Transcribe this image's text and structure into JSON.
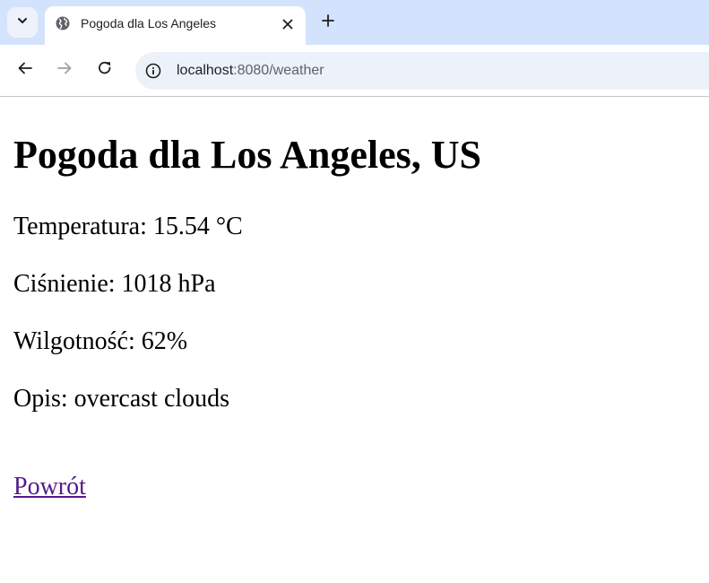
{
  "browser": {
    "tab": {
      "title": "Pogoda dla Los Angeles"
    },
    "address_bar": {
      "host": "localhost",
      "path": ":8080/weather"
    },
    "icons": {
      "tab_menu": "chevron-down-icon",
      "favicon": "globe-icon",
      "tab_close": "close-icon",
      "new_tab": "plus-icon",
      "back": "arrow-left-icon",
      "forward": "arrow-right-icon",
      "reload": "reload-icon",
      "site_info": "info-icon"
    }
  },
  "page": {
    "heading": "Pogoda dla Los Angeles, US",
    "temperature": "Temperatura: 15.54 °C",
    "pressure": "Ciśnienie: 1018 hPa",
    "humidity": "Wilgotność: 62%",
    "description": "Opis: overcast clouds",
    "back_link": "Powrót"
  },
  "colors": {
    "tabstrip": "#d3e3fd",
    "omnibox": "#edf2fa",
    "visited_link": "#551a8b"
  }
}
